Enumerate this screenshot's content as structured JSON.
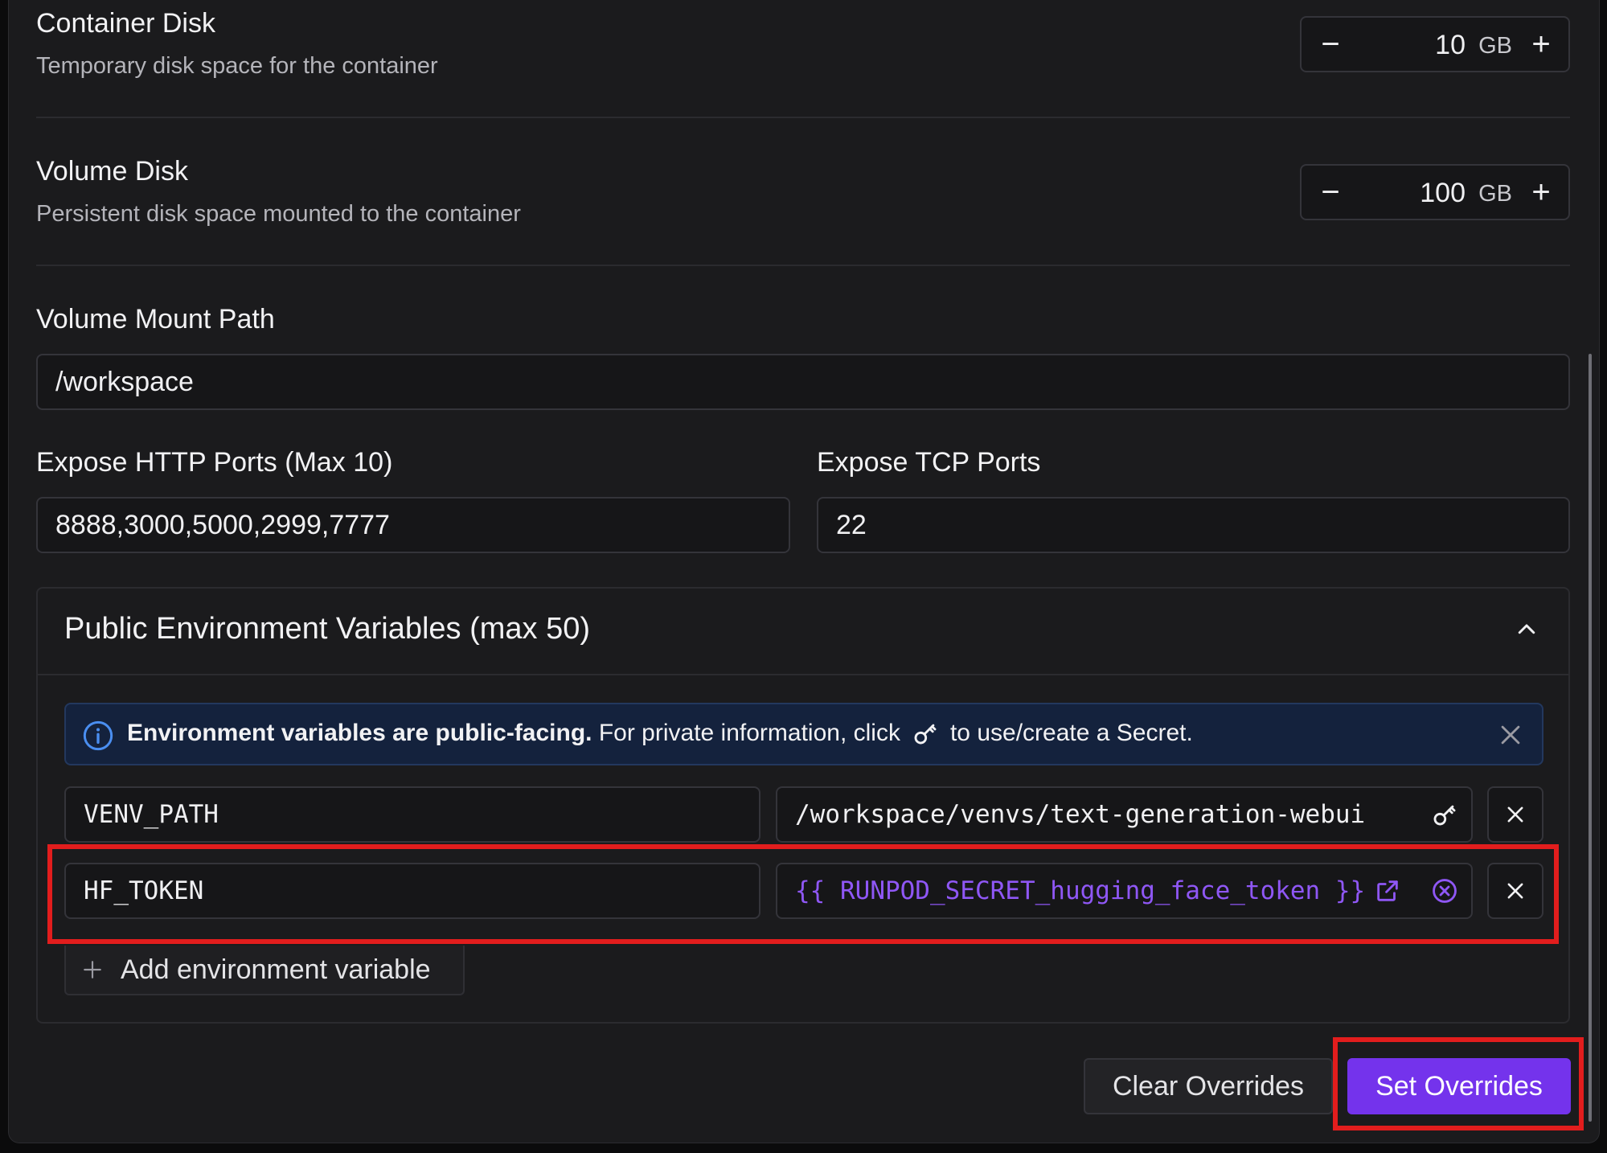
{
  "container_disk": {
    "title": "Container Disk",
    "subtitle": "Temporary disk space for the container",
    "value": "10",
    "unit": "GB",
    "minus": "−",
    "plus": "+"
  },
  "volume_disk": {
    "title": "Volume Disk",
    "subtitle": "Persistent disk space mounted to the container",
    "value": "100",
    "unit": "GB",
    "minus": "−",
    "plus": "+"
  },
  "volume_mount_path": {
    "label": "Volume Mount Path",
    "value": "/workspace"
  },
  "http_ports": {
    "label": "Expose HTTP Ports (Max 10)",
    "value": "8888,3000,5000,2999,7777"
  },
  "tcp_ports": {
    "label": "Expose TCP Ports",
    "value": "22"
  },
  "env_section": {
    "title": "Public Environment Variables (max 50)",
    "collapse_icon": "chevron-up-icon",
    "alert": {
      "bold": "Environment variables are public-facing.",
      "text_before": "For private information, click",
      "text_after": "to use/create a Secret.",
      "icon": "info-icon"
    },
    "variables": [
      {
        "key": "VENV_PATH",
        "value": "/workspace/venvs/text-generation-webui",
        "is_secret": false
      },
      {
        "key": "HF_TOKEN",
        "value": "{{ RUNPOD_SECRET_hugging_face_token }}",
        "is_secret": true
      }
    ],
    "add_label": "Add environment variable"
  },
  "actions": {
    "clear_label": "Clear Overrides",
    "set_label": "Set Overrides"
  },
  "colors": {
    "accent": "#7433ec",
    "secret_text": "#8f57f5",
    "highlight": "#e21d1d",
    "alert_bg": "#14223d"
  }
}
